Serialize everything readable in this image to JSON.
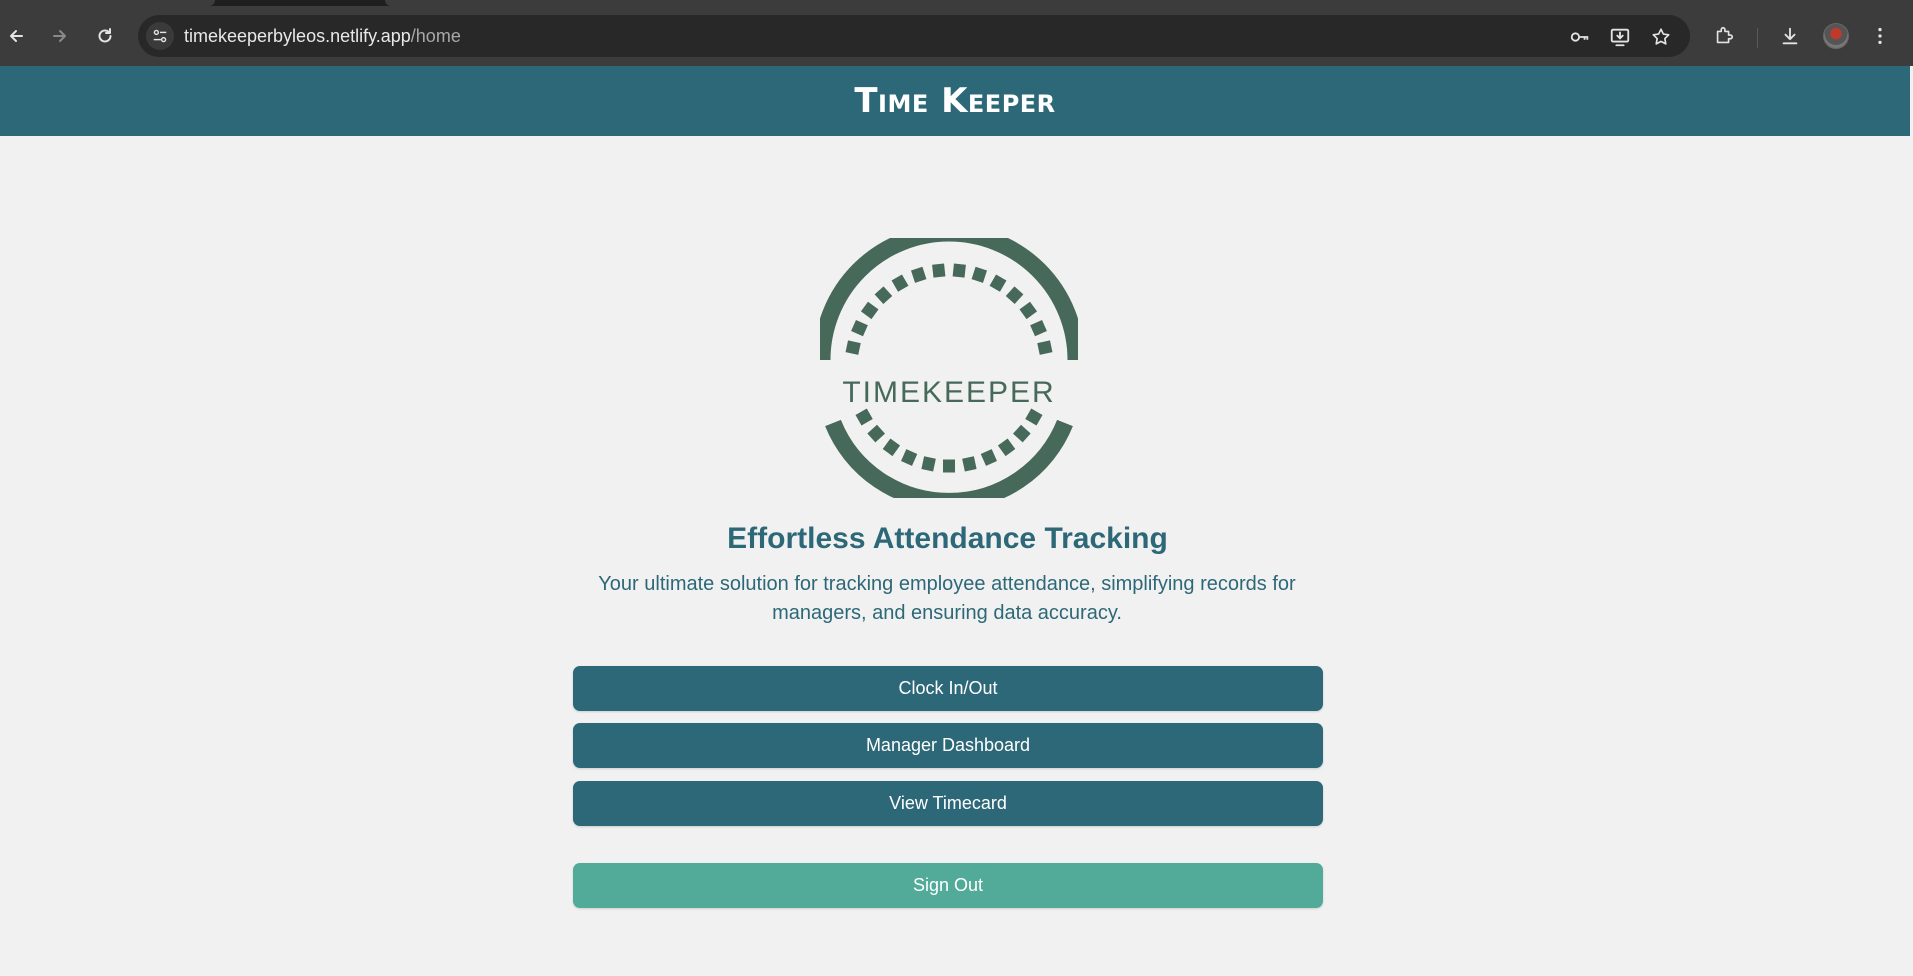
{
  "browser": {
    "url_host": "timekeeperbyleos.netlify.app",
    "url_path": "/home",
    "icons": {
      "back": "back-arrow-icon",
      "forward": "forward-arrow-icon",
      "reload": "reload-icon",
      "site_info": "tune-icon",
      "password": "key-icon",
      "install": "install-app-icon",
      "bookmark": "star-icon",
      "extensions": "puzzle-icon",
      "downloads": "download-icon",
      "menu": "kebab-menu-icon"
    }
  },
  "header": {
    "title": "Time Keeper"
  },
  "logo": {
    "text": "TIMEKEEPER",
    "color": "#46695a"
  },
  "main": {
    "headline": "Effortless Attendance Tracking",
    "description": "Your ultimate solution for tracking employee attendance, simplifying records for managers, and ensuring data accuracy."
  },
  "actions": {
    "clock_in_out": "Clock In/Out",
    "manager_dashboard": "Manager Dashboard",
    "view_timecard": "View Timecard",
    "sign_out": "Sign Out"
  },
  "colors": {
    "primary": "#2d6878",
    "secondary": "#52ab98",
    "background": "#f1f1f1"
  }
}
